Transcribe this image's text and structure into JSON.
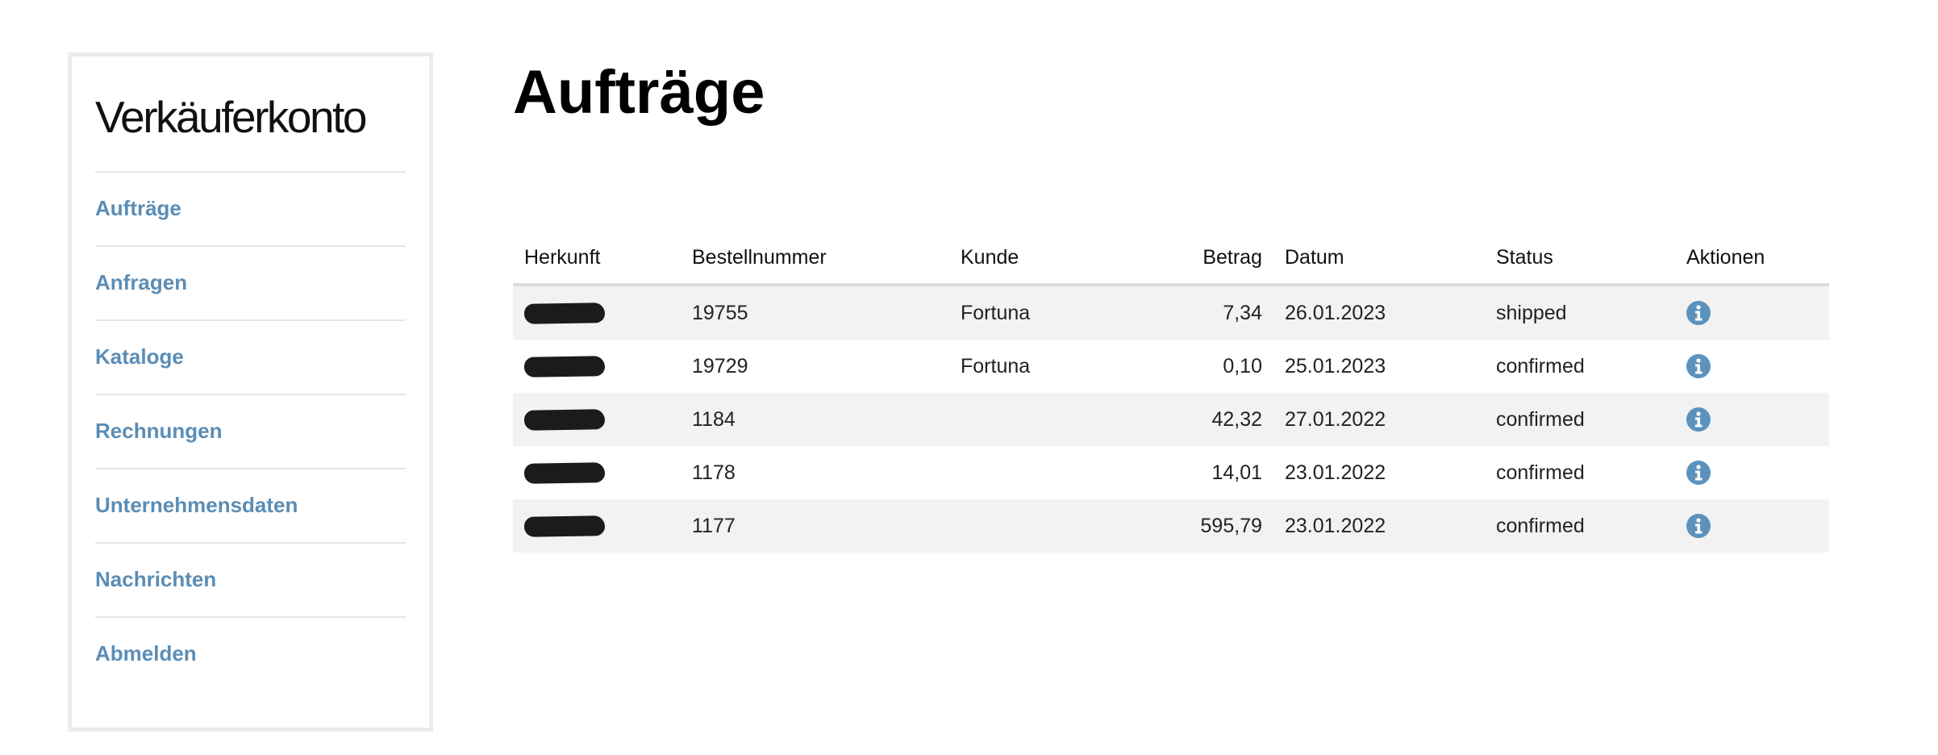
{
  "sidebar": {
    "title": "Verkäuferkonto",
    "items": [
      {
        "label": "Aufträge"
      },
      {
        "label": "Anfragen"
      },
      {
        "label": "Kataloge"
      },
      {
        "label": "Rechnungen"
      },
      {
        "label": "Unternehmensdaten"
      },
      {
        "label": "Nachrichten"
      },
      {
        "label": "Abmelden"
      }
    ]
  },
  "main": {
    "title": "Aufträge",
    "table": {
      "headers": {
        "herkunft": "Herkunft",
        "bestellnummer": "Bestellnummer",
        "kunde": "Kunde",
        "betrag": "Betrag",
        "datum": "Datum",
        "status": "Status",
        "aktionen": "Aktionen"
      },
      "rows": [
        {
          "herkunft": "[redacted]",
          "bestellnummer": "19755",
          "kunde": "Fortuna",
          "betrag": "7,34",
          "datum": "26.01.2023",
          "status": "shipped",
          "action_icon": "info-icon"
        },
        {
          "herkunft": "[redacted]",
          "bestellnummer": "19729",
          "kunde": "Fortuna",
          "betrag": "0,10",
          "datum": "25.01.2023",
          "status": "confirmed",
          "action_icon": "info-icon"
        },
        {
          "herkunft": "[redacted]",
          "bestellnummer": "1184",
          "kunde": "",
          "betrag": "42,32",
          "datum": "27.01.2022",
          "status": "confirmed",
          "action_icon": "info-icon"
        },
        {
          "herkunft": "[redacted]",
          "bestellnummer": "1178",
          "kunde": "",
          "betrag": "14,01",
          "datum": "23.01.2022",
          "status": "confirmed",
          "action_icon": "info-icon"
        },
        {
          "herkunft": "[redacted]",
          "bestellnummer": "1177",
          "kunde": "",
          "betrag": "595,79",
          "datum": "23.01.2022",
          "status": "confirmed",
          "action_icon": "info-icon"
        }
      ]
    }
  },
  "colors": {
    "link": "#5b8db5",
    "info_icon": "#5b92bd",
    "row_stripe": "#f2f2f2",
    "border": "#ececec"
  }
}
